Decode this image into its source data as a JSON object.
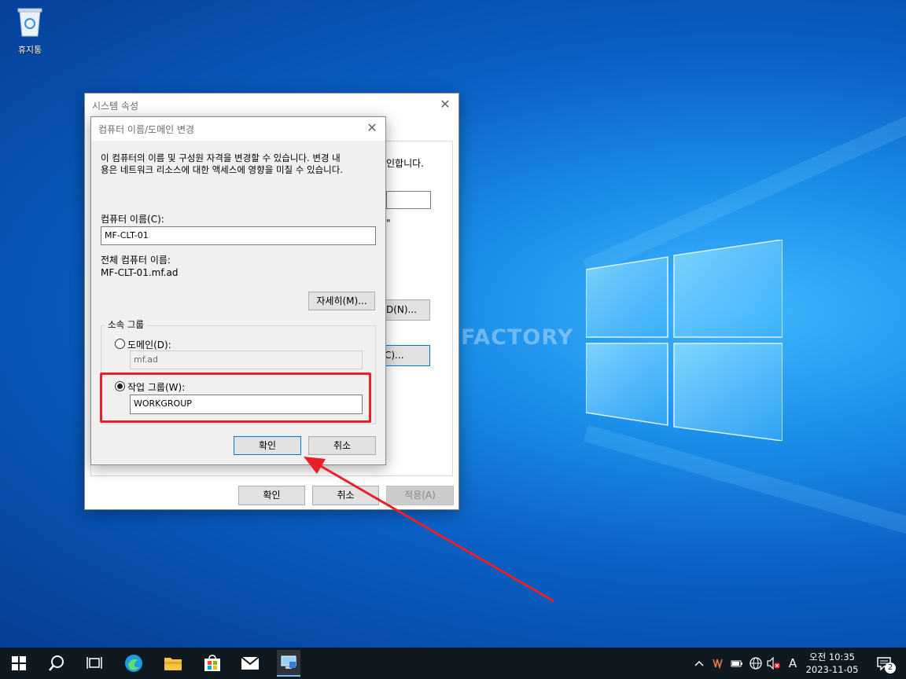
{
  "desktop": {
    "recycle_bin_label": "휴지통",
    "watermark": "MANUAL FACTORY"
  },
  "system_properties": {
    "title": "시스템 속성",
    "partial_text_right": "인합니다.",
    "partial_quote": "\"",
    "partial_button_change": "D(N)...",
    "partial_button_2": "C)...",
    "ok_label": "확인",
    "cancel_label": "취소",
    "apply_label": "적용(A)"
  },
  "change_dialog": {
    "title": "컴퓨터 이름/도메인 변경",
    "description_line1": "이 컴퓨터의 이름 및 구성원 자격을 변경할 수 있습니다. 변경 내",
    "description_line2": "용은 네트워크 리소스에 대한 액세스에 영향을 미칠 수 있습니다.",
    "computer_name_label": "컴퓨터 이름(C):",
    "computer_name_value": "MF-CLT-01",
    "full_name_label": "전체 컴퓨터 이름:",
    "full_name_value": "MF-CLT-01.mf.ad",
    "more_button": "자세히(M)...",
    "member_of_label": "소속 그룹",
    "domain_label": "도메인(D):",
    "domain_value": "mf.ad",
    "workgroup_label": "작업 그룹(W):",
    "workgroup_value": "WORKGROUP",
    "ok_label": "확인",
    "cancel_label": "취소"
  },
  "taskbar": {
    "ime_indicator": "A",
    "time": "오전 10:35",
    "date": "2023-11-05",
    "notification_count": "2"
  },
  "colors": {
    "highlight_box": "#e8202a",
    "arrow": "#e8202a",
    "taskbar_bg": "#101820"
  }
}
